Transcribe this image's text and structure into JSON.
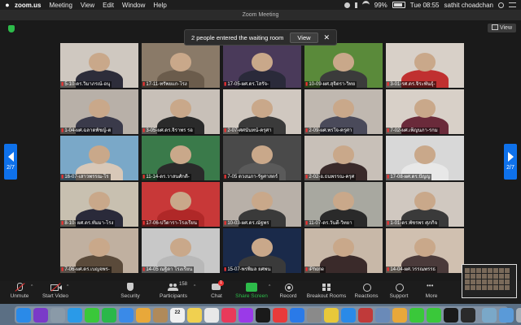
{
  "menubar": {
    "app": "zoom.us",
    "items": [
      "Meeting",
      "View",
      "Edit",
      "Window",
      "Help"
    ],
    "battery": "99%",
    "clock": "Tue 08:55",
    "user": "sathit choadchan"
  },
  "window": {
    "title": "Zoom Meeting",
    "view_label": "View"
  },
  "banner": {
    "text": "2 people entered the waiting room",
    "view_button": "View",
    "close": "✕"
  },
  "nav": {
    "page_left": "2/7",
    "page_right": "2/7"
  },
  "tiles": [
    {
      "label": "5-10-ดร.วิมาภรณ์-อนุ",
      "bg": "#cfc8c0",
      "body": "#2d2d3a"
    },
    {
      "label": "17-11-ทรัพยแก-โรง",
      "bg": "#8a7a68",
      "body": "#6b5c4c"
    },
    {
      "label": "17-05-ผศ.ดร.โสรัจ-",
      "bg": "#4a3a5a",
      "body": "#2a2a3a"
    },
    {
      "label": "10-09-ผศ.สุจิตรา-วิทย",
      "bg": "#5a8a3a",
      "body": "#3b3b3b"
    },
    {
      "label": "3-01-รศ.ดร.จิระพันธุ์-",
      "bg": "#d8d0c8",
      "body": "#c03030"
    },
    {
      "label": "1-04-ผศ.ฉลาดพัชญ์-ต",
      "bg": "#b8b0a8",
      "body": "#3a3a4a"
    },
    {
      "label": "3-05-ผศ.ดร.จิราพร รอ",
      "bg": "#c8c0b8",
      "body": "#2a2a2a"
    },
    {
      "label": "2-07-ศศนันทน์-ครุศา",
      "bg": "#d0c8c0",
      "body": "#3a3a3a"
    },
    {
      "label": "2-09-ผศ.พรใจ-ครุศา",
      "bg": "#c0b8b0",
      "body": "#4a4a5a"
    },
    {
      "label": "7-02-ผศ.เพ็ญนภา-รกม",
      "bg": "#d8d0c8",
      "body": "#6a2a3a"
    },
    {
      "label": "16-07-เสาวพรรณ-โร",
      "bg": "#7aa8c8",
      "body": "#d8c8b8"
    },
    {
      "label": "11-14-ดร.วาสนศักดิ์-",
      "bg": "#3a7a4a",
      "body": "#2a2a2a"
    },
    {
      "label": "7-05 ดวงนภา-รัฐศาสตร์",
      "bg": "#4a4a4a",
      "body": "#5a5a5a"
    },
    {
      "label": "2-02-อ.ธนพรรณ-ครุศ",
      "bg": "#c8c0b8",
      "body": "#3a2a2a"
    },
    {
      "label": "17-08-ผศ.ดร.ปัญญ",
      "bg": "#d8d8d8",
      "body": "#e8e8e8"
    },
    {
      "label": "8-10- ผศ.ดร.ทัมมา-โรง",
      "bg": "#c8c0b0",
      "body": "#2a2a3a"
    },
    {
      "label": "17-06-ปวีดารา-โรงเรียน",
      "bg": "#c83838",
      "body": "#b02828"
    },
    {
      "label": "10-03-ผศ.ดร.ณัฐพร",
      "bg": "#b8b0a8",
      "body": "#3a3a3a"
    },
    {
      "label": "11-07-ดร.วันดี-วิทยา",
      "bg": "#a8a8a0",
      "body": "#2a2a2a"
    },
    {
      "label": "1-01-ดร.พัชรพร ศุภกิจ",
      "bg": "#d0c8c0",
      "body": "#3a3a3a"
    },
    {
      "label": "7-06-ผศ.ดร.เบญจพร-",
      "bg": "#c0b0a0",
      "body": "#5a4a3a"
    },
    {
      "label": "14-05 ณฐิดา โรงเรียน",
      "bg": "#c8c8c8",
      "body": "#b8b8b8"
    },
    {
      "label": "15-07-พรพิมล ยศพน",
      "bg": "#1a2a4a",
      "body": "#3a3a3a"
    },
    {
      "label": "iPhone",
      "bg": "#c8b8a8",
      "body": "#3a2a2a"
    },
    {
      "label": "14-04-ผศ.วรรณพรรธ",
      "bg": "#d0c0b0",
      "body": "#4a3a3a"
    }
  ],
  "toolbar": {
    "unmute": "Unmute",
    "start_video": "Start Video",
    "security": "Security",
    "participants": "Participants",
    "participants_count": "158",
    "chat": "Chat",
    "chat_badge": "1",
    "share": "Share Screen",
    "record": "Record",
    "breakout": "Breakout Rooms",
    "reactions": "Reactions",
    "support": "Support",
    "more": "More"
  },
  "dock": {
    "calendar_day": "22",
    "apps": [
      {
        "name": "finder",
        "color": "#2a8ae8",
        "label": ""
      },
      {
        "name": "siri",
        "color": "#7a3ac8",
        "label": ""
      },
      {
        "name": "launchpad",
        "color": "#8a9aa8",
        "label": ""
      },
      {
        "name": "safari",
        "color": "#2a9ae8",
        "label": ""
      },
      {
        "name": "messages",
        "color": "#3ac83a",
        "label": ""
      },
      {
        "name": "facetime",
        "color": "#2ab84a",
        "label": ""
      },
      {
        "name": "mail",
        "color": "#3a8ae8",
        "label": ""
      },
      {
        "name": "photos",
        "color": "#e8a83a",
        "label": ""
      },
      {
        "name": "contacts",
        "color": "#b08a5a",
        "label": ""
      },
      {
        "name": "calendar",
        "color": "#f0f0f0",
        "label": ""
      },
      {
        "name": "notes",
        "color": "#f0d050",
        "label": ""
      },
      {
        "name": "reminders",
        "color": "#e8e8e8",
        "label": ""
      },
      {
        "name": "music",
        "color": "#e83a5a",
        "label": ""
      },
      {
        "name": "podcasts",
        "color": "#9a3ae8",
        "label": ""
      },
      {
        "name": "apple-tv",
        "color": "#1a1a1a",
        "label": ""
      },
      {
        "name": "news",
        "color": "#e83a3a",
        "label": ""
      },
      {
        "name": "app-store",
        "color": "#2a7ae8",
        "label": ""
      },
      {
        "name": "system-preferences",
        "color": "#8a8a8a",
        "label": ""
      },
      {
        "name": "chrome",
        "color": "#e8c83a",
        "label": ""
      },
      {
        "name": "zoom",
        "color": "#2a8ae8",
        "label": ""
      },
      {
        "name": "sketchbook",
        "color": "#c03a3a",
        "label": ""
      },
      {
        "name": "preview",
        "color": "#6a8ab8",
        "label": ""
      },
      {
        "name": "pages",
        "color": "#e8a83a",
        "label": ""
      },
      {
        "name": "wechat",
        "color": "#3ac83a",
        "label": ""
      },
      {
        "name": "line",
        "color": "#3ac83a",
        "label": ""
      },
      {
        "name": "terminal",
        "color": "#1a1a1a",
        "label": ""
      },
      {
        "name": "obs",
        "color": "#2a2a2a",
        "label": ""
      },
      {
        "name": "finder-window",
        "color": "#7aa8c8",
        "label": ""
      },
      {
        "name": "folder",
        "color": "#5a9ad8",
        "label": ""
      },
      {
        "name": "trash",
        "color": "#a8b0b8",
        "label": ""
      }
    ]
  }
}
